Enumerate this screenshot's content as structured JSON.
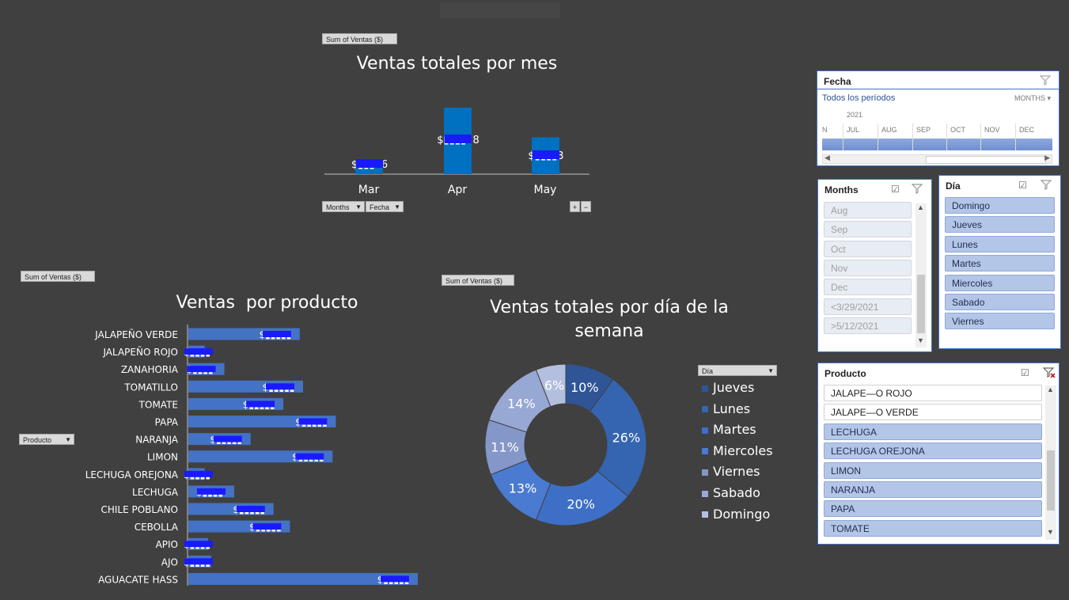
{
  "top_bar": {
    "placeholder": ""
  },
  "monthly_chart": {
    "field_button": "Sum of Ventas ($)",
    "title": "Ventas totales por mes",
    "filter_buttons": [
      "Months",
      "Fecha"
    ],
    "expand_buttons": [
      "+",
      "−"
    ]
  },
  "product_chart": {
    "field_button": "Sum of Ventas ($)",
    "title": "Ventas  por producto",
    "filter_button": "Producto"
  },
  "day_chart": {
    "field_button": "Sum of Ventas ($)",
    "title_line1": "Ventas totales por día de la",
    "title_line2": "semana",
    "legend_filter": "Día"
  },
  "colors": {
    "background": "#404040",
    "bar": "#0070c0",
    "hbar": "#4472c4",
    "redaction": "#1a1aff"
  },
  "chart_data": [
    {
      "type": "bar",
      "title": "Ventas totales por mes",
      "categories": [
        "Mar",
        "Apr",
        "May"
      ],
      "values": [
        6,
        56,
        31
      ],
      "data_labels": [
        "$▮▮▮46",
        "$▮▮▮▮78",
        "$▮▮▮▮3"
      ],
      "ylim": [
        0,
        60
      ]
    },
    {
      "type": "bar",
      "orientation": "horizontal",
      "title": "Ventas  por producto",
      "categories": [
        "JALAPEÑO VERDE",
        "JALAPEÑO ROJO",
        "ZANAHORIA",
        "TOMATILLO",
        "TOMATE",
        "PAPA",
        "NARANJA",
        "LIMON",
        "LECHUGA OREJONA",
        "LECHUGA",
        "CHILE POBLANO",
        "CEBOLLA",
        "APIO",
        "AJO",
        "AGUACATE HASS"
      ],
      "values": [
        17,
        2.5,
        5.5,
        17.5,
        14.5,
        22.5,
        9.5,
        22,
        2.5,
        7,
        13,
        15.5,
        3,
        3.5,
        35
      ],
      "data_labels": [
        "$▮▮▮▮▮",
        "$▮▮▮▮",
        "$▮▮▮▮",
        "$▮▮▮▮▮",
        "$▮▮▮▮▮",
        "$▮▮▮▮▮",
        "$▮▮▮▮▮",
        "$▮▮▮▮▮",
        "$▮▮▮▮",
        "$▮▮▮▮",
        "$▮▮▮▮▮",
        "$▮▮▮▮▮",
        "$▮▮▮▮",
        "$▮▮▮▮",
        "$▮▮▮▮▮"
      ]
    },
    {
      "type": "pie",
      "variant": "doughnut",
      "title": "Ventas totales por día de la semana",
      "slices": [
        {
          "label": "Jueves",
          "value": 10,
          "text": "10%",
          "color": "#2f5597"
        },
        {
          "label": "Lunes",
          "value": 26,
          "text": "26%",
          "color": "#3565b0"
        },
        {
          "label": "Martes",
          "value": 20,
          "text": "20%",
          "color": "#3d6fc6"
        },
        {
          "label": "Miercoles",
          "value": 13,
          "text": "13%",
          "color": "#4a7bd0"
        },
        {
          "label": "Viernes",
          "value": 11,
          "text": "11%",
          "color": "#8497c8"
        },
        {
          "label": "Sabado",
          "value": 14,
          "text": "14%",
          "color": "#98a8d4"
        },
        {
          "label": "Domingo",
          "value": 6,
          "text": "6%",
          "color": "#b4bfe0"
        }
      ],
      "legend_order": [
        "Jueves",
        "Lunes",
        "Martes",
        "Miercoles",
        "Viernes",
        "Sabado",
        "Domingo"
      ],
      "legend_position": "right"
    }
  ],
  "slicer_fecha": {
    "title": "Fecha",
    "period_label": "Todos los períodos",
    "level": "MONTHS",
    "year": "2021",
    "months": [
      "N",
      "JUL",
      "AUG",
      "SEP",
      "OCT",
      "NOV",
      "DEC"
    ]
  },
  "slicer_months": {
    "title": "Months",
    "items": [
      "Aug",
      "Sep",
      "Oct",
      "Nov",
      "Dec",
      "<3/29/2021",
      ">5/12/2021"
    ]
  },
  "slicer_dia": {
    "title": "Día",
    "items": [
      "Domingo",
      "Jueves",
      "Lunes",
      "Martes",
      "Miercoles",
      "Sabado",
      "Viernes"
    ]
  },
  "slicer_producto": {
    "title": "Producto",
    "items": [
      {
        "label": "JALAPE—O ROJO",
        "state": "unsel"
      },
      {
        "label": "JALAPE—O VERDE",
        "state": "unsel"
      },
      {
        "label": "LECHUGA",
        "state": "sel"
      },
      {
        "label": "LECHUGA OREJONA",
        "state": "sel"
      },
      {
        "label": "LIMON",
        "state": "sel"
      },
      {
        "label": "NARANJA",
        "state": "sel"
      },
      {
        "label": "PAPA",
        "state": "sel"
      },
      {
        "label": "TOMATE",
        "state": "sel"
      }
    ]
  }
}
